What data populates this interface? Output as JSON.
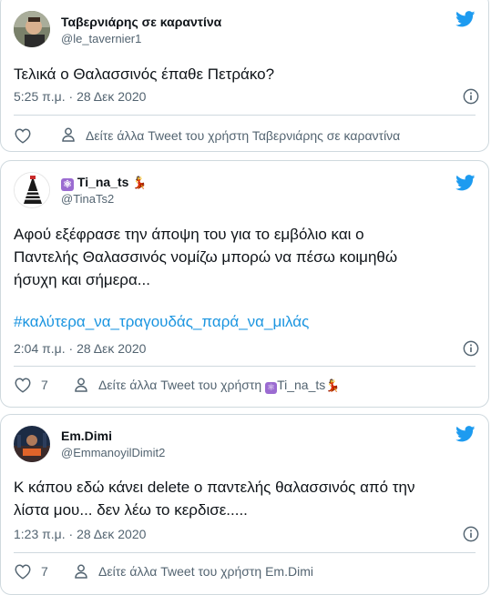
{
  "tweets": [
    {
      "name": "Ταβερνιάρης σε καραντίνα",
      "handle": "@le_tavernier1",
      "text_lines": [
        "Τελικά ο Θαλασσινός έπαθε Πετράκο?"
      ],
      "time": "5:25 π.μ. · 28 Δεκ 2020",
      "likes": "",
      "more": "Δείτε άλλα Tweet του χρήστη Ταβερνιάρης σε καραντίνα"
    },
    {
      "name_emoji_left": "⚛",
      "name": "Ti_na_ts",
      "name_emoji_right": "💃",
      "handle": "@TinaTs2",
      "text_lines": [
        "Αφού εξέφρασε την άποψη του για το εμβόλιο και ο",
        "Παντελής Θαλασσινός νομίζω μπορώ να πέσω κοιμηθώ",
        "ήσυχη και σήμερα..."
      ],
      "hashtag": "#καλύτερα_να_τραγουδάς_παρά_να_μιλάς",
      "time": "2:04 π.μ. · 28 Δεκ 2020",
      "likes": "7",
      "more_prefix": "Δείτε άλλα Tweet του χρήστη",
      "more_name": "Ti_na_ts"
    },
    {
      "name": "Em.Dimi",
      "handle": "@EmmanoyilDimit2",
      "text_lines": [
        "Κ κάπου εδώ κάνει delete ο παντελής θαλασσινός από την",
        "λίστα μου... δεν λέω το κερδισε....."
      ],
      "time": "1:23 π.μ. · 28 Δεκ 2020",
      "likes": "7",
      "more": "Δείτε άλλα Tweet του χρήστη Em.Dimi"
    }
  ],
  "icons": {
    "bird": "twitter-bird-icon",
    "info": "info-icon",
    "heart": "heart-icon",
    "person": "person-icon"
  },
  "colors": {
    "brand": "#1d9bf0",
    "hashtag": "#1b95e0",
    "secondary": "#536471",
    "border": "#cfd9de"
  }
}
